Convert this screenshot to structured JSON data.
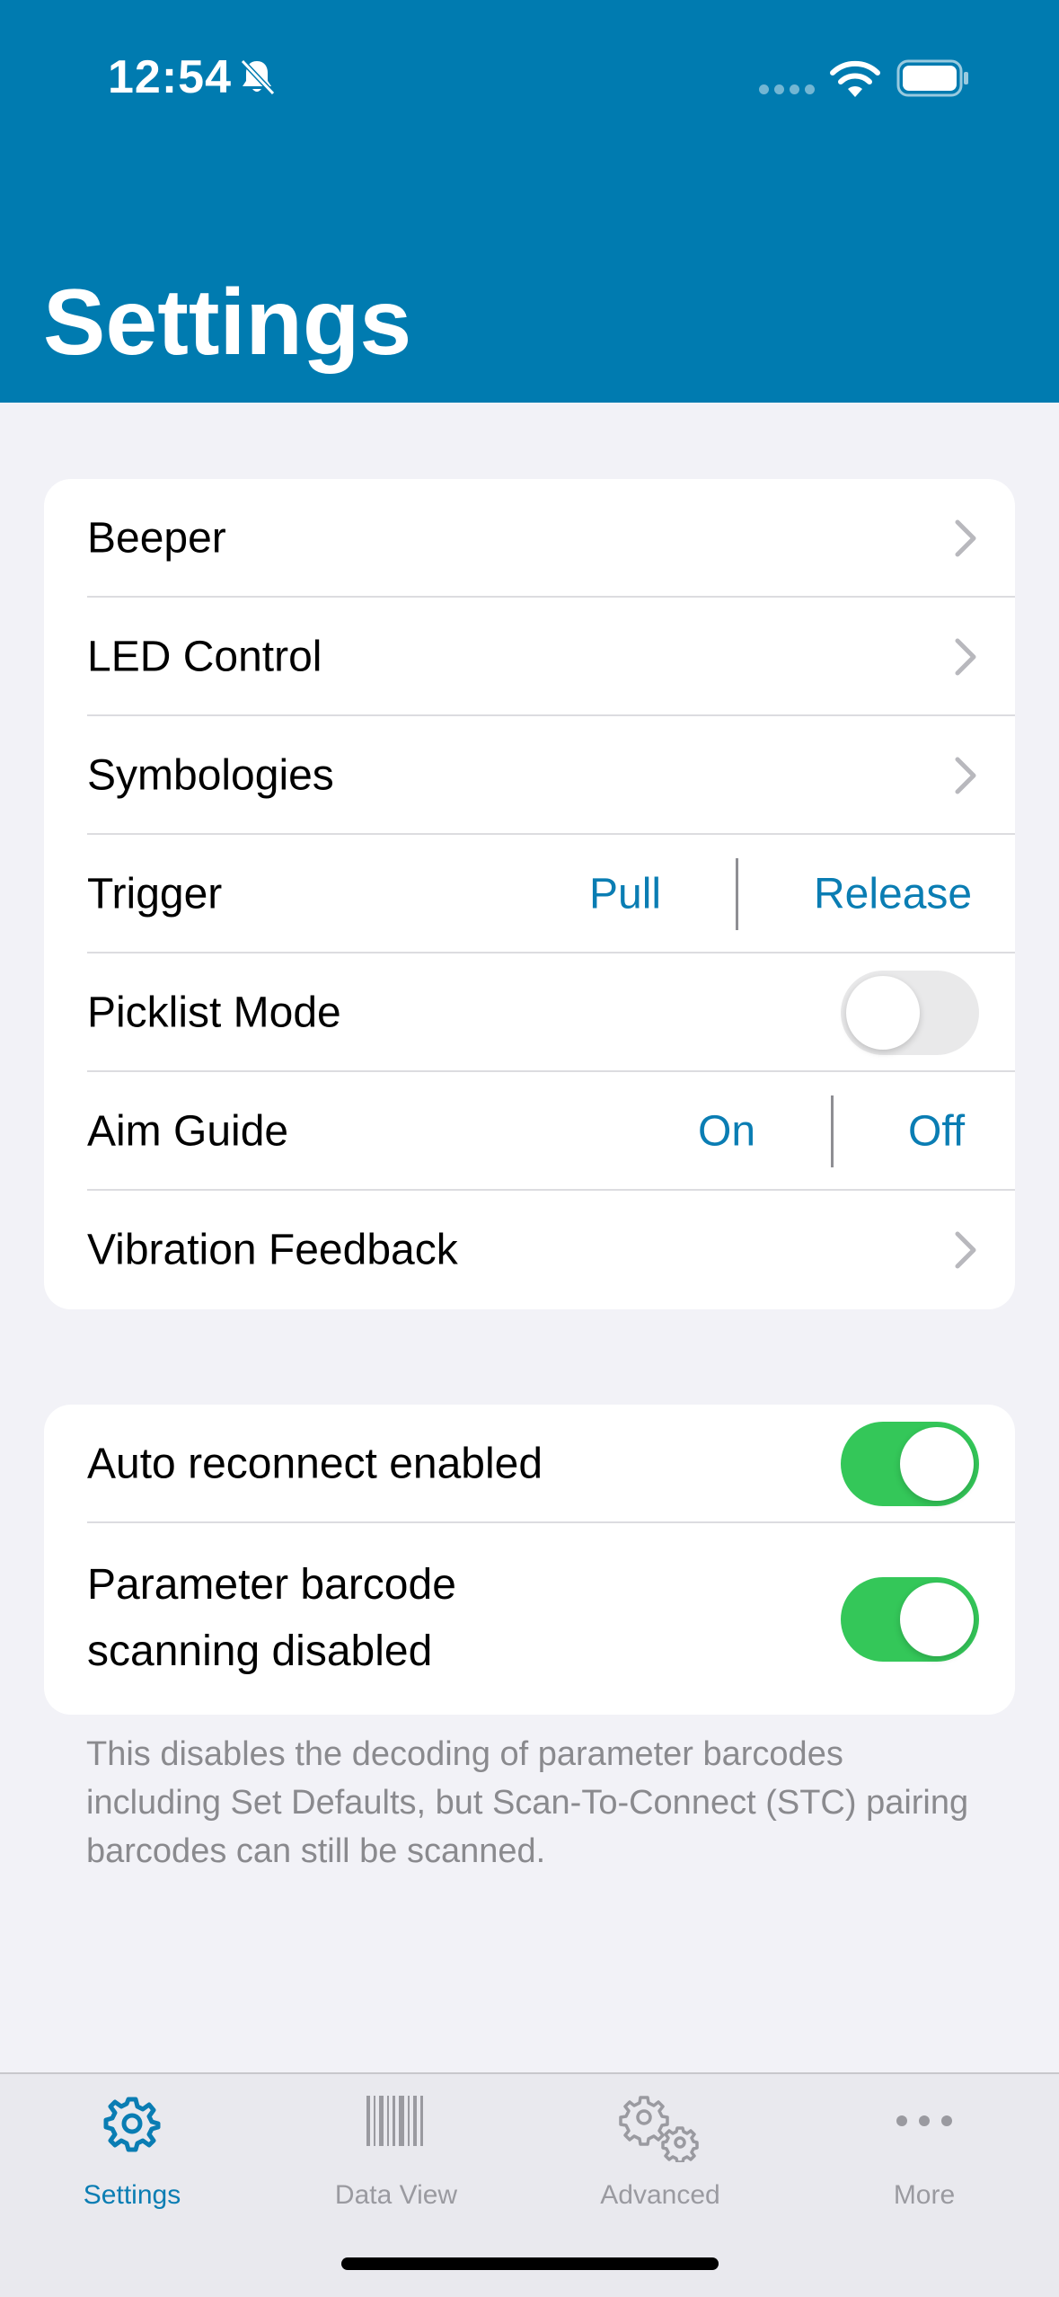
{
  "status_bar": {
    "time": "12:54"
  },
  "header": {
    "title": "Settings"
  },
  "section1": {
    "beeper_label": "Beeper",
    "led_label": "LED Control",
    "symbologies_label": "Symbologies",
    "trigger": {
      "label": "Trigger",
      "option_a": "Pull",
      "option_b": "Release"
    },
    "picklist": {
      "label": "Picklist Mode",
      "enabled": false
    },
    "aim_guide": {
      "label": "Aim Guide",
      "option_a": "On",
      "option_b": "Off"
    },
    "vibration_label": "Vibration Feedback"
  },
  "section2": {
    "auto_reconnect": {
      "label": "Auto reconnect enabled",
      "enabled": true
    },
    "param_barcode": {
      "label_line1": "Parameter barcode",
      "label_line2": "scanning disabled",
      "enabled": true
    },
    "footnote": "This disables the decoding of parameter barcodes including Set Defaults, but Scan-To-Connect (STC) pairing barcodes can still be scanned."
  },
  "tabs": [
    {
      "label": "Settings",
      "icon": "gear-icon",
      "active": true
    },
    {
      "label": "Data View",
      "icon": "barcode-icon",
      "active": false
    },
    {
      "label": "Advanced",
      "icon": "gears-icon",
      "active": false
    },
    {
      "label": "More",
      "icon": "ellipsis-icon",
      "active": false
    }
  ],
  "colors": {
    "brand": "#007bb0",
    "accent": "#0a7db3",
    "toggle_on": "#34c759"
  }
}
